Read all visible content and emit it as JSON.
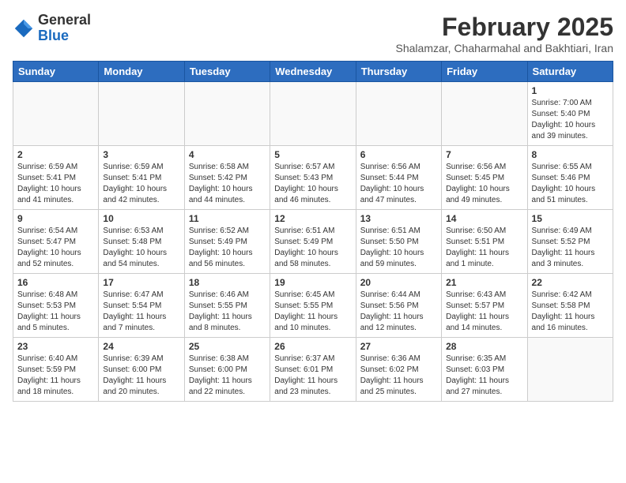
{
  "header": {
    "logo_general": "General",
    "logo_blue": "Blue",
    "title": "February 2025",
    "subtitle": "Shalamzar, Chaharmahal and Bakhtiari, Iran"
  },
  "weekdays": [
    "Sunday",
    "Monday",
    "Tuesday",
    "Wednesday",
    "Thursday",
    "Friday",
    "Saturday"
  ],
  "weeks": [
    [
      {
        "day": "",
        "info": ""
      },
      {
        "day": "",
        "info": ""
      },
      {
        "day": "",
        "info": ""
      },
      {
        "day": "",
        "info": ""
      },
      {
        "day": "",
        "info": ""
      },
      {
        "day": "",
        "info": ""
      },
      {
        "day": "1",
        "info": "Sunrise: 7:00 AM\nSunset: 5:40 PM\nDaylight: 10 hours\nand 39 minutes."
      }
    ],
    [
      {
        "day": "2",
        "info": "Sunrise: 6:59 AM\nSunset: 5:41 PM\nDaylight: 10 hours\nand 41 minutes."
      },
      {
        "day": "3",
        "info": "Sunrise: 6:59 AM\nSunset: 5:41 PM\nDaylight: 10 hours\nand 42 minutes."
      },
      {
        "day": "4",
        "info": "Sunrise: 6:58 AM\nSunset: 5:42 PM\nDaylight: 10 hours\nand 44 minutes."
      },
      {
        "day": "5",
        "info": "Sunrise: 6:57 AM\nSunset: 5:43 PM\nDaylight: 10 hours\nand 46 minutes."
      },
      {
        "day": "6",
        "info": "Sunrise: 6:56 AM\nSunset: 5:44 PM\nDaylight: 10 hours\nand 47 minutes."
      },
      {
        "day": "7",
        "info": "Sunrise: 6:56 AM\nSunset: 5:45 PM\nDaylight: 10 hours\nand 49 minutes."
      },
      {
        "day": "8",
        "info": "Sunrise: 6:55 AM\nSunset: 5:46 PM\nDaylight: 10 hours\nand 51 minutes."
      }
    ],
    [
      {
        "day": "9",
        "info": "Sunrise: 6:54 AM\nSunset: 5:47 PM\nDaylight: 10 hours\nand 52 minutes."
      },
      {
        "day": "10",
        "info": "Sunrise: 6:53 AM\nSunset: 5:48 PM\nDaylight: 10 hours\nand 54 minutes."
      },
      {
        "day": "11",
        "info": "Sunrise: 6:52 AM\nSunset: 5:49 PM\nDaylight: 10 hours\nand 56 minutes."
      },
      {
        "day": "12",
        "info": "Sunrise: 6:51 AM\nSunset: 5:49 PM\nDaylight: 10 hours\nand 58 minutes."
      },
      {
        "day": "13",
        "info": "Sunrise: 6:51 AM\nSunset: 5:50 PM\nDaylight: 10 hours\nand 59 minutes."
      },
      {
        "day": "14",
        "info": "Sunrise: 6:50 AM\nSunset: 5:51 PM\nDaylight: 11 hours\nand 1 minute."
      },
      {
        "day": "15",
        "info": "Sunrise: 6:49 AM\nSunset: 5:52 PM\nDaylight: 11 hours\nand 3 minutes."
      }
    ],
    [
      {
        "day": "16",
        "info": "Sunrise: 6:48 AM\nSunset: 5:53 PM\nDaylight: 11 hours\nand 5 minutes."
      },
      {
        "day": "17",
        "info": "Sunrise: 6:47 AM\nSunset: 5:54 PM\nDaylight: 11 hours\nand 7 minutes."
      },
      {
        "day": "18",
        "info": "Sunrise: 6:46 AM\nSunset: 5:55 PM\nDaylight: 11 hours\nand 8 minutes."
      },
      {
        "day": "19",
        "info": "Sunrise: 6:45 AM\nSunset: 5:55 PM\nDaylight: 11 hours\nand 10 minutes."
      },
      {
        "day": "20",
        "info": "Sunrise: 6:44 AM\nSunset: 5:56 PM\nDaylight: 11 hours\nand 12 minutes."
      },
      {
        "day": "21",
        "info": "Sunrise: 6:43 AM\nSunset: 5:57 PM\nDaylight: 11 hours\nand 14 minutes."
      },
      {
        "day": "22",
        "info": "Sunrise: 6:42 AM\nSunset: 5:58 PM\nDaylight: 11 hours\nand 16 minutes."
      }
    ],
    [
      {
        "day": "23",
        "info": "Sunrise: 6:40 AM\nSunset: 5:59 PM\nDaylight: 11 hours\nand 18 minutes."
      },
      {
        "day": "24",
        "info": "Sunrise: 6:39 AM\nSunset: 6:00 PM\nDaylight: 11 hours\nand 20 minutes."
      },
      {
        "day": "25",
        "info": "Sunrise: 6:38 AM\nSunset: 6:00 PM\nDaylight: 11 hours\nand 22 minutes."
      },
      {
        "day": "26",
        "info": "Sunrise: 6:37 AM\nSunset: 6:01 PM\nDaylight: 11 hours\nand 23 minutes."
      },
      {
        "day": "27",
        "info": "Sunrise: 6:36 AM\nSunset: 6:02 PM\nDaylight: 11 hours\nand 25 minutes."
      },
      {
        "day": "28",
        "info": "Sunrise: 6:35 AM\nSunset: 6:03 PM\nDaylight: 11 hours\nand 27 minutes."
      },
      {
        "day": "",
        "info": ""
      }
    ]
  ]
}
